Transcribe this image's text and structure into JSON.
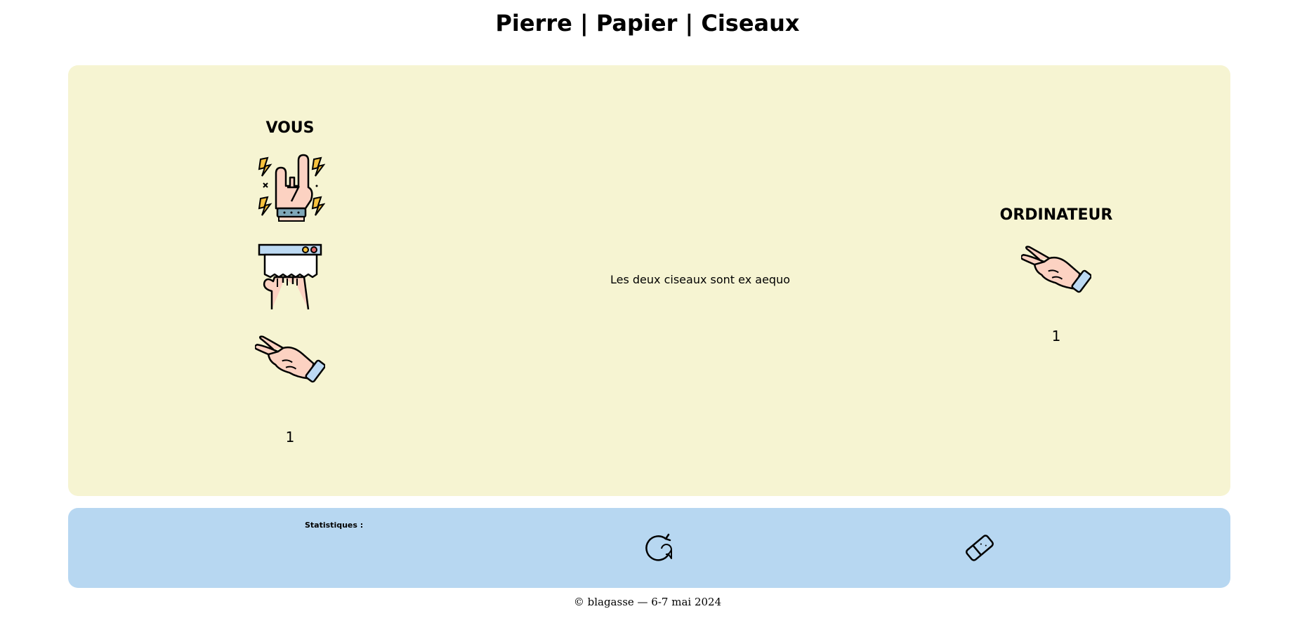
{
  "page": {
    "title": "Pierre | Papier | Ciseaux"
  },
  "player": {
    "heading": "VOUS",
    "choices": [
      {
        "name": "pierre",
        "icon": "rock-hand-icon"
      },
      {
        "name": "papier",
        "icon": "paper-hand-icon"
      },
      {
        "name": "ciseaux",
        "icon": "scissors-hand-icon"
      }
    ],
    "score": "1"
  },
  "result": {
    "message": "Les deux ciseaux sont ex aequo"
  },
  "computer": {
    "heading": "ORDINATEUR",
    "choice_icon": "scissors-hand-icon",
    "score": "1"
  },
  "stats": {
    "label": "Statistiques :",
    "replay_icon": "replay-icon",
    "reset_icon": "eraser-icon"
  },
  "footer": {
    "text": "© blagasse — 6-7 mai 2024"
  },
  "colors": {
    "game_panel": "#f6f4d2",
    "stats_panel": "#b7d7f1",
    "skin": "#fcd2c2",
    "cuff": "#bcd9f3",
    "bolt": "#f7c23c"
  }
}
